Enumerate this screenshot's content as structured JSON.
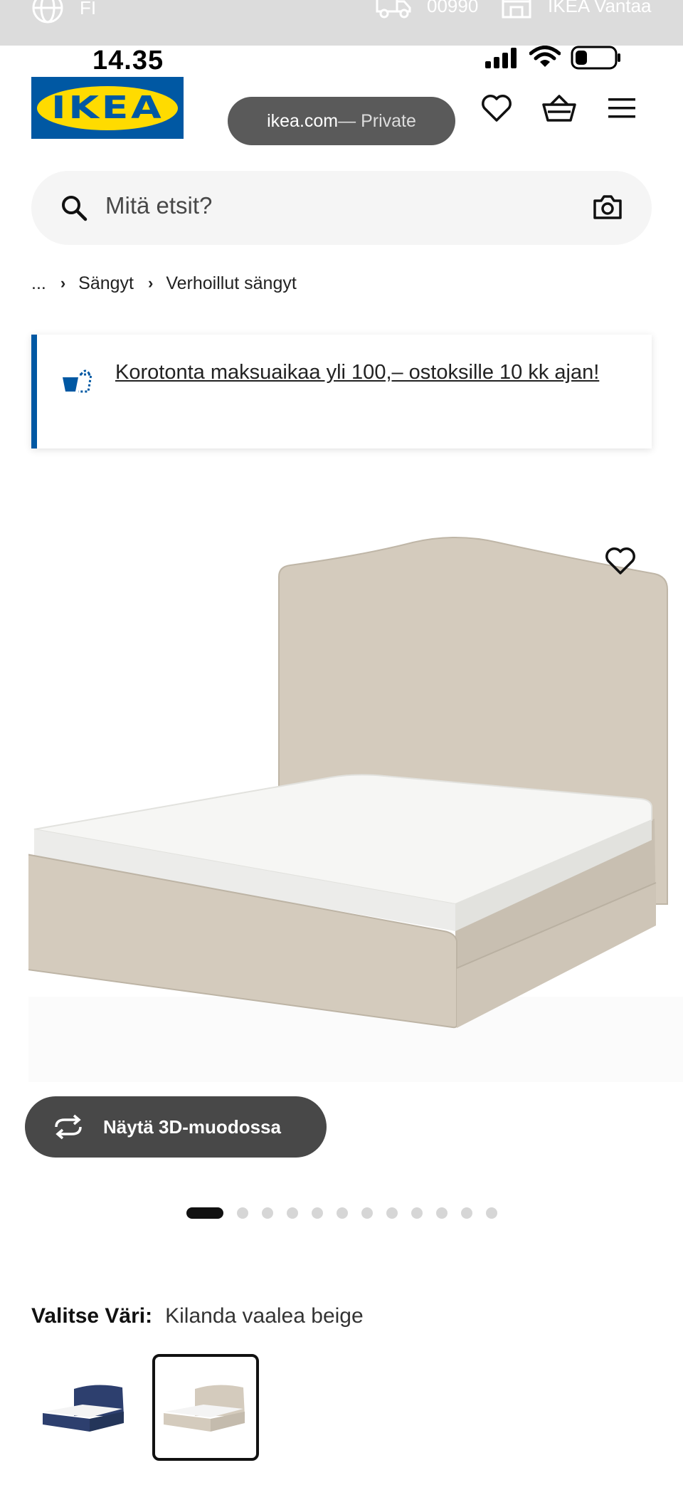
{
  "top_strip": {
    "language": "FI",
    "postal_code": "00990",
    "store": "IKEA Vantaa"
  },
  "status_bar": {
    "time": "14.35",
    "battery_level": 0.3
  },
  "header": {
    "logo_text": "IKEA",
    "url_domain": "ikea.com",
    "url_mode": " — Private"
  },
  "search": {
    "placeholder": "Mitä etsit?"
  },
  "breadcrumb": {
    "ellipsis": "...",
    "items": [
      "Sängyt",
      "Verhoillut sängyt"
    ]
  },
  "promo": {
    "text": "Korotonta maksuaikaa yli 100,– ostoksille 10 kk ajan!"
  },
  "product": {
    "view_3d_label": "Näytä 3D-muodossa",
    "image_count": 12,
    "active_image": 1
  },
  "color_choice": {
    "label": "Valitse Väri:",
    "selected_value": "Kilanda vaalea beige",
    "swatches": [
      {
        "name": "dark-blue",
        "color": "#2d3f6e",
        "selected": false
      },
      {
        "name": "light-beige",
        "color": "#cfc6b8",
        "selected": true
      }
    ]
  },
  "colors": {
    "brand_blue": "#0058a3",
    "brand_yellow": "#ffdb00",
    "fabric": "#d4cbbd"
  }
}
